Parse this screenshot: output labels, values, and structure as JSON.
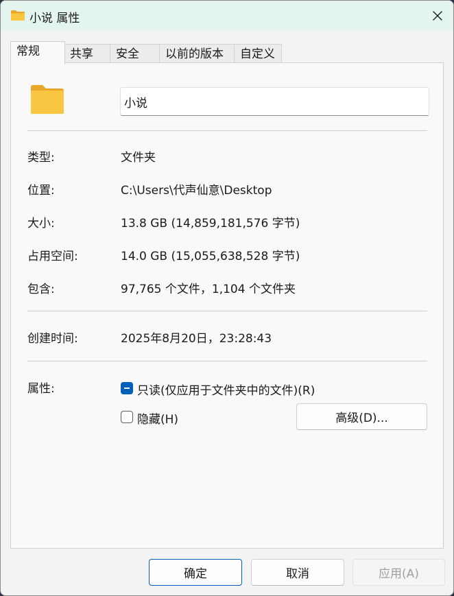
{
  "window": {
    "title": "小说 属性",
    "close_label": "✕"
  },
  "tabs": [
    {
      "label": "常规",
      "active": true
    },
    {
      "label": "共享"
    },
    {
      "label": "安全"
    },
    {
      "label": "以前的版本"
    },
    {
      "label": "自定义"
    }
  ],
  "general": {
    "folder_name": "小说",
    "properties": [
      {
        "label": "类型:",
        "value": "文件夹"
      },
      {
        "label": "位置:",
        "value": "C:\\Users\\代声仙意\\Desktop"
      },
      {
        "label": "大小:",
        "value": "13.8 GB (14,859,181,576 字节)"
      },
      {
        "label": "占用空间:",
        "value": "14.0 GB (15,055,638,528 字节)"
      },
      {
        "label": "包含:",
        "value": "97,765 个文件，1,104 个文件夹"
      }
    ],
    "created": {
      "label": "创建时间:",
      "value": "2025年8月20日，23:28:43"
    },
    "attributes": {
      "label": "属性:",
      "readonly_label": "只读(仅应用于文件夹中的文件)(R)",
      "hidden_label": "隐藏(H)",
      "advanced_label": "高级(D)..."
    }
  },
  "buttons": {
    "ok": "确定",
    "cancel": "取消",
    "apply": "应用(A)"
  },
  "colors": {
    "accent": "#005fb8",
    "titlebar": "#e4f4ef",
    "folder": "#f8c640"
  },
  "icons": {
    "title_icon": "folder-icon",
    "big_icon": "folder-icon",
    "close": "close-icon"
  }
}
